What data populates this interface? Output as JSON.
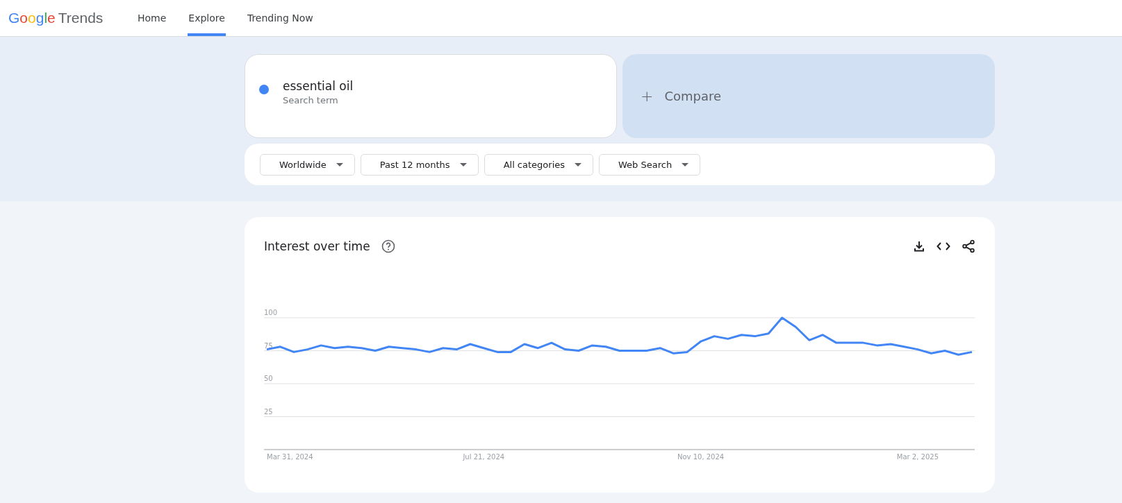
{
  "header": {
    "logo": {
      "google": "Google",
      "product": "Trends"
    },
    "nav": [
      {
        "label": "Home",
        "selected": false
      },
      {
        "label": "Explore",
        "selected": true
      },
      {
        "label": "Trending Now",
        "selected": false
      }
    ]
  },
  "search": {
    "term": {
      "label": "essential oil",
      "sublabel": "Search term",
      "color": "#4285f4"
    },
    "compare": {
      "icon": "+",
      "label": "Compare"
    }
  },
  "filters": [
    {
      "label": "Worldwide"
    },
    {
      "label": "Past 12 months"
    },
    {
      "label": "All categories"
    },
    {
      "label": "Web Search"
    }
  ],
  "interest_over_time": {
    "title": "Interest over time",
    "x_axis_labels": [
      "Mar 31, 2024",
      "Jul 21, 2024",
      "Nov 10, 2024",
      "Mar 2, 2025"
    ],
    "chart_data": {
      "type": "line",
      "grid": true,
      "series": [
        {
          "color": "#4285f4",
          "values": [
            76,
            78,
            74,
            76,
            79,
            77,
            78,
            77,
            75,
            78,
            77,
            76,
            74,
            77,
            76,
            80,
            77,
            74,
            74,
            80,
            77,
            81,
            76,
            75,
            79,
            78,
            75,
            75,
            75,
            77,
            73,
            74,
            82,
            86,
            84,
            87,
            86,
            88,
            100,
            93,
            83,
            87,
            81,
            81,
            81,
            79,
            80,
            78,
            76,
            73,
            75,
            72,
            74
          ]
        }
      ],
      "ylim": [
        0,
        100
      ],
      "yticks": [
        25,
        50,
        75,
        100
      ]
    }
  }
}
